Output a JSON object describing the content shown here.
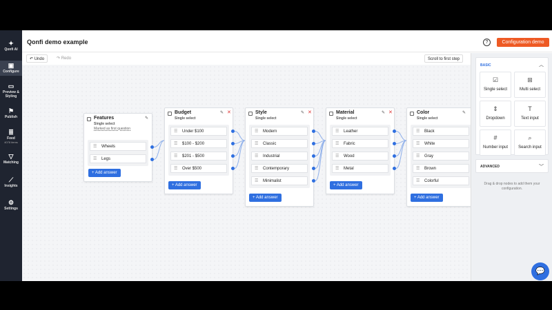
{
  "app": {
    "title": "Qonfi demo example",
    "config_button": "Configuration demo",
    "help_icon": "?"
  },
  "nav": [
    {
      "label": "Qonfi AI",
      "icon": "✦"
    },
    {
      "label": "Configure",
      "icon": "▣",
      "active": true
    },
    {
      "label": "Preview & Styling",
      "icon": "▭"
    },
    {
      "label": "Publish",
      "icon": "⚑"
    },
    {
      "label": "Feed",
      "sub": "4078 items",
      "icon": "≣"
    },
    {
      "label": "Matching",
      "icon": "▽"
    },
    {
      "label": "Insights",
      "icon": "⟋"
    },
    {
      "label": "Settings",
      "icon": "⚙"
    }
  ],
  "toolbar": {
    "undo": "↶ Undo",
    "redo": "↷ Redo",
    "scroll": "Scroll to first step"
  },
  "nodes": [
    {
      "title": "Features",
      "subtitle": "Single select",
      "note": "Marked as first question",
      "answers": [
        "Wheels",
        "Legs"
      ],
      "add": "+ Add answer"
    },
    {
      "title": "Budget",
      "subtitle": "Single select",
      "answers": [
        "Under $100",
        "$100 - $200",
        "$201 - $500",
        "Over $500"
      ],
      "add": "+ Add answer"
    },
    {
      "title": "Style",
      "subtitle": "Single select",
      "answers": [
        "Modern",
        "Classic",
        "Industrial",
        "Contemporary",
        "Minimalist"
      ],
      "add": "+ Add answer"
    },
    {
      "title": "Material",
      "subtitle": "Single select",
      "answers": [
        "Leather",
        "Fabric",
        "Wood",
        "Metal"
      ],
      "add": "+ Add answer"
    },
    {
      "title": "Color",
      "subtitle": "Single select",
      "answers": [
        "Black",
        "White",
        "Gray",
        "Brown",
        "Colorful"
      ],
      "add": "+ Add answer"
    }
  ],
  "zoom": {
    "minus": "−",
    "plus": "+"
  },
  "panel": {
    "basic_title": "BASIC",
    "tiles": [
      {
        "label": "Single select",
        "icon": "☑"
      },
      {
        "label": "Multi select",
        "icon": "⊞"
      },
      {
        "label": "Dropdown",
        "icon": "⇕"
      },
      {
        "label": "Text input",
        "icon": "T"
      },
      {
        "label": "Number input",
        "icon": "#"
      },
      {
        "label": "Search input",
        "icon": "⌕"
      }
    ],
    "advanced_title": "ADVANCED",
    "hint": "Drag & drop nodes to add them your configuration.",
    "accent": "#2f6fe0"
  }
}
